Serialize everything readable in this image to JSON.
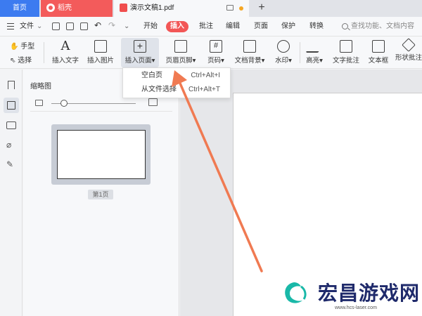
{
  "tabs": {
    "home": "首页",
    "daoke": "稻壳",
    "document": "演示文稿1.pdf",
    "new_tab": "+"
  },
  "menu": {
    "file": "文件",
    "items": [
      "开始",
      "插入",
      "批注",
      "编辑",
      "页面",
      "保护",
      "转换"
    ],
    "active": "插入",
    "search_placeholder": "查找功能、文档内容"
  },
  "ribbon": {
    "hand": "手型",
    "select": "选择",
    "buttons": [
      {
        "label": "插入文字",
        "icon": "text-insert-icon"
      },
      {
        "label": "插入图片",
        "icon": "image-insert-icon"
      },
      {
        "label": "插入页面",
        "icon": "page-insert-icon",
        "dropdown": true,
        "active": true
      },
      {
        "label": "页眉页脚",
        "icon": "header-footer-icon",
        "dropdown": true
      },
      {
        "label": "页码",
        "icon": "page-number-icon",
        "dropdown": true
      },
      {
        "label": "文档背景",
        "icon": "background-icon",
        "dropdown": true
      },
      {
        "label": "水印",
        "icon": "watermark-icon",
        "dropdown": true
      },
      {
        "label": "高亮",
        "icon": "highlight-icon",
        "dropdown": true
      },
      {
        "label": "文字批注",
        "icon": "text-comment-icon"
      },
      {
        "label": "文本框",
        "icon": "textbox-icon"
      },
      {
        "label": "形状批注",
        "icon": "shape-comment-icon"
      }
    ]
  },
  "dropdown": {
    "items": [
      {
        "label": "空白页",
        "shortcut": "Ctrl+Alt+I"
      },
      {
        "label": "从文件选择",
        "shortcut": "Ctrl+Alt+T"
      }
    ]
  },
  "thumbnail_panel": {
    "title": "缩略图",
    "zoom_fraction": 0.15,
    "page_label": "第1页"
  },
  "watermark": {
    "text": "宏昌游戏网",
    "url": "www.hcs-laser.com"
  },
  "colors": {
    "accent_red": "#f25656",
    "home_tab_blue": "#3c7bf0",
    "arrow_orange": "#f07a52"
  }
}
